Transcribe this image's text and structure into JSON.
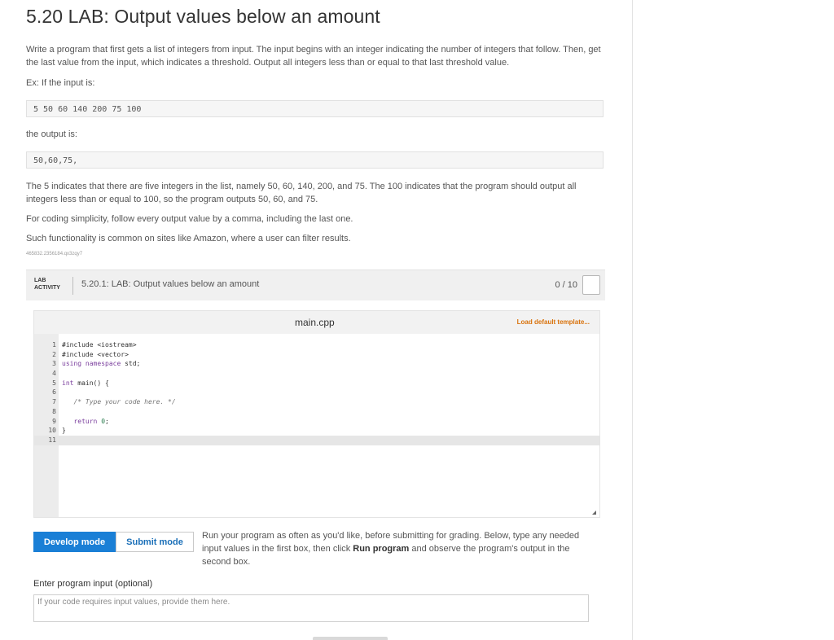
{
  "title": "5.20 LAB: Output values below an amount",
  "description": {
    "para1": "Write a program that first gets a list of integers from input. The input begins with an integer indicating the number of integers that follow. Then, get the last value from the input, which indicates a threshold. Output all integers less than or equal to that last threshold value.",
    "example_intro": "Ex: If the input is:",
    "example_input": "5 50 60 140 200 75 100",
    "output_intro": "the output is:",
    "example_output": "50,60,75,",
    "para2": "The 5 indicates that there are five integers in the list, namely 50, 60, 140, 200, and 75. The 100 indicates that the program should output all integers less than or equal to 100, so the program outputs 50, 60, and 75.",
    "para3": "For coding simplicity, follow every output value by a comma, including the last one.",
    "para4": "Such functionality is common on sites like Amazon, where a user can filter results.",
    "hash": "465832.2356184.qx3zqy7"
  },
  "lab": {
    "tag_line1": "LAB",
    "tag_line2": "ACTIVITY",
    "title": "5.20.1: LAB: Output values below an amount",
    "score": "0 / 10"
  },
  "editor": {
    "file_name": "main.cpp",
    "load_template": "Load default template...",
    "lines": [
      {
        "n": "1",
        "text": "#include <iostream>"
      },
      {
        "n": "2",
        "text": "#include <vector>"
      },
      {
        "n": "3",
        "text": "using namespace std;"
      },
      {
        "n": "4",
        "text": ""
      },
      {
        "n": "5",
        "text": "int main() {"
      },
      {
        "n": "6",
        "text": ""
      },
      {
        "n": "7",
        "text": "   /* Type your code here. */"
      },
      {
        "n": "8",
        "text": ""
      },
      {
        "n": "9",
        "text": "   return 0;"
      },
      {
        "n": "10",
        "text": "}"
      },
      {
        "n": "11",
        "text": ""
      }
    ]
  },
  "modes": {
    "develop": "Develop mode",
    "submit": "Submit mode"
  },
  "run_help": {
    "part1": "Run your program as often as you'd like, before submitting for grading. Below, type any needed input values in the first box, then click ",
    "bold": "Run program",
    "part2": " and observe the program's output in the second box."
  },
  "input": {
    "label": "Enter program input (optional)",
    "placeholder": "If your code requires input values, provide them here."
  }
}
